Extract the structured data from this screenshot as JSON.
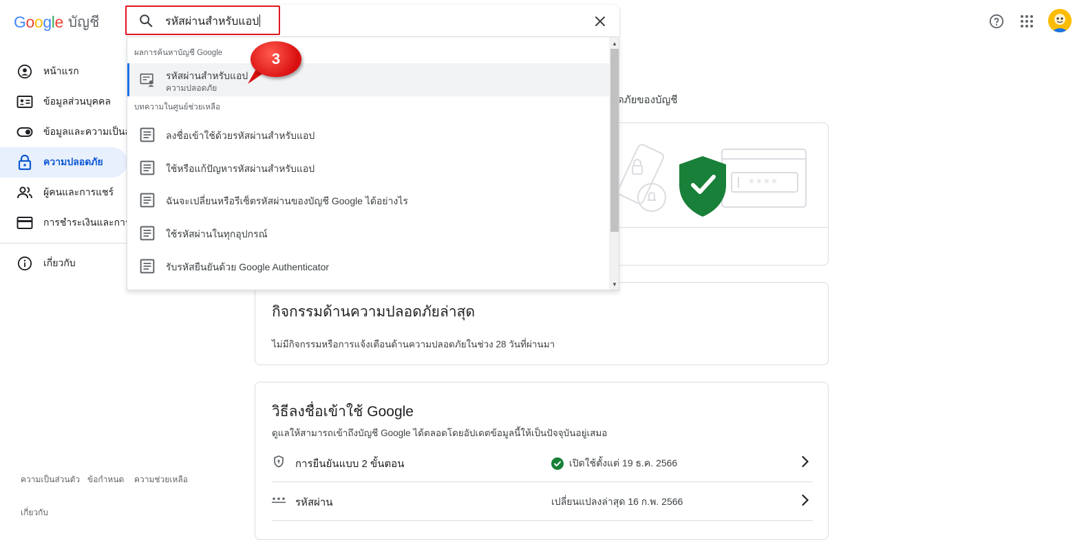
{
  "header": {
    "logo_suffix": "บัญชี",
    "help_label": "?",
    "apps_label": "Google apps"
  },
  "search": {
    "value": "รหัสผ่านสำหรับแอป",
    "clear_label": "×"
  },
  "dropdown": {
    "account_section": "ผลการค้นหาบัญชี Google",
    "account_results": [
      {
        "title": "รหัสผ่านสำหรับแอป",
        "subtitle": "ความปลอดภัย"
      }
    ],
    "help_section": "บทความในศูนย์ช่วยเหลือ",
    "help_results": [
      "ลงชื่อเข้าใช้ด้วยรหัสผ่านสำหรับแอป",
      "ใช้หรือแก้ปัญหารหัสผ่านสำหรับแอป",
      "ฉันจะเปลี่ยนหรือรีเซ็ตรหัสผ่านของบัญชี Google ได้อย่างไร",
      "ใช้รหัสผ่านในทุกอุปกรณ์",
      "รับรหัสยืนยันด้วย Google Authenticator"
    ]
  },
  "annotation": {
    "step": "3"
  },
  "sidebar": {
    "items": [
      {
        "label": "หน้าแรก",
        "icon": "account-circle-icon"
      },
      {
        "label": "ข้อมูลส่วนบุคคล",
        "icon": "id-card-icon"
      },
      {
        "label": "ข้อมูลและความเป็นส่วนตัว",
        "icon": "toggle-icon"
      },
      {
        "label": "ความปลอดภัย",
        "icon": "lock-icon"
      },
      {
        "label": "ผู้คนและการแชร์",
        "icon": "people-icon"
      },
      {
        "label": "การชำระเงินและการสมัครใช้บริการ",
        "icon": "credit-card-icon"
      },
      {
        "label": "เกี่ยวกับ",
        "icon": "info-icon"
      }
    ],
    "active_index": 3
  },
  "footer": {
    "privacy": "ความเป็นส่วนตัว",
    "terms": "ข้อกำหนด",
    "help": "ความช่วยเหลือ",
    "about": "เกี่ยวกับ"
  },
  "main": {
    "partial_text": "อดภัยของบัญชี",
    "activity": {
      "title": "กิจกรรมด้านความปลอดภัยล่าสุด",
      "subtitle": "ไม่มีกิจกรรมหรือการแจ้งเตือนด้านความปลอดภัยในช่วง 28 วันที่ผ่านมา"
    },
    "signin": {
      "title": "วิธีลงชื่อเข้าใช้ Google",
      "subtitle": "ดูแลให้สามารถเข้าถึงบัญชี Google ได้ตลอดโดยอัปเดตข้อมูลนี้ให้เป็นปัจจุบันอยู่เสมอ",
      "rows": [
        {
          "label": "การยืนยันแบบ 2 ขั้นตอน",
          "status": "เปิดใช้ตั้งแต่ 19 ธ.ค. 2566",
          "status_ok": true
        },
        {
          "label": "รหัสผ่าน",
          "status": "เปลี่ยนแปลงล่าสุด 16 ก.พ. 2566",
          "status_ok": false
        }
      ]
    }
  },
  "colors": {
    "accent": "#0b57d0",
    "active_bg": "#e8f0fe",
    "shield": "#188038",
    "highlight": "#e0141e"
  }
}
